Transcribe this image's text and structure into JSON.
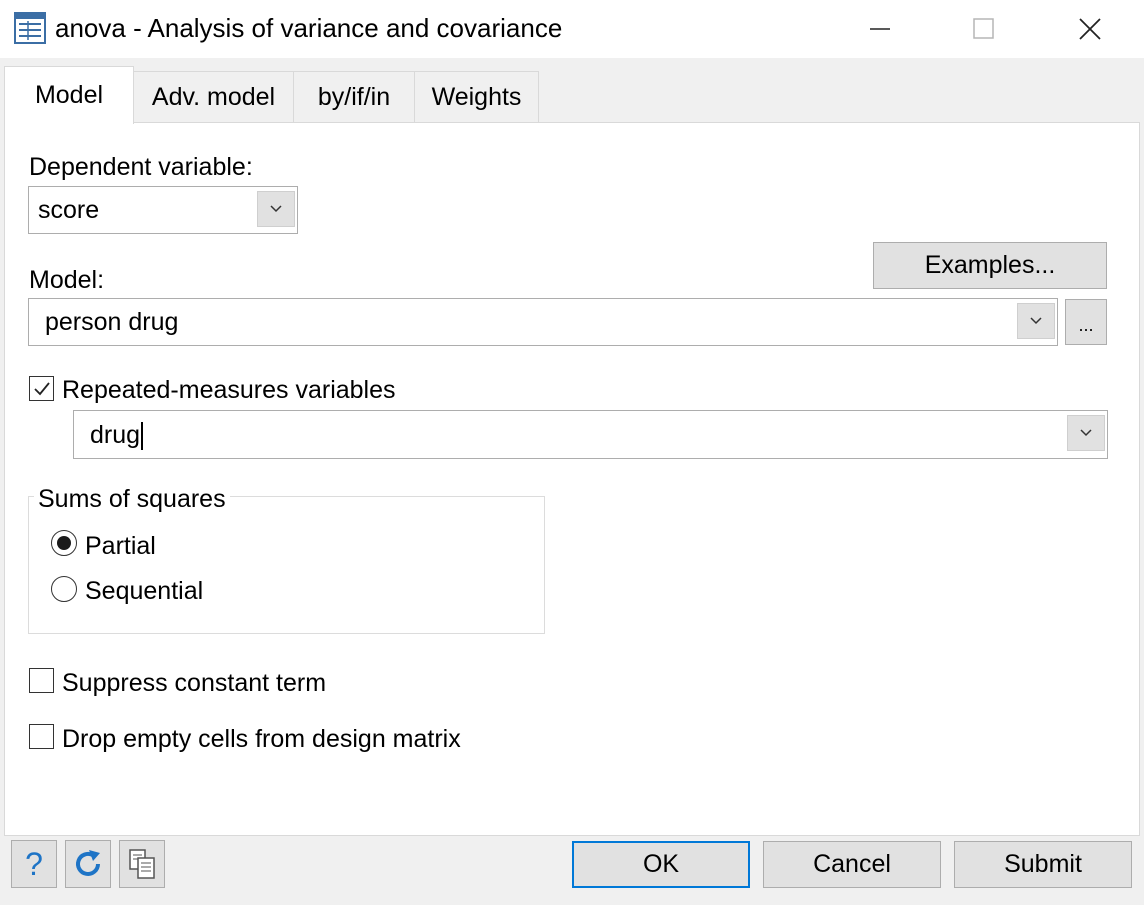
{
  "window": {
    "title": "anova - Analysis of variance and covariance",
    "icons": {
      "app": "dialog-icon",
      "minimize": "minimize-icon",
      "maximize": "maximize-icon",
      "close": "close-icon"
    }
  },
  "tabs": [
    {
      "label": "Model",
      "active": true
    },
    {
      "label": "Adv. model",
      "active": false
    },
    {
      "label": "by/if/in",
      "active": false
    },
    {
      "label": "Weights",
      "active": false
    }
  ],
  "model_tab": {
    "dependent_label": "Dependent variable:",
    "dependent_value": "score",
    "model_label": "Model:",
    "model_value": "person drug",
    "examples_button": "Examples...",
    "browse_button": "...",
    "repeated_label": "Repeated-measures variables",
    "repeated_checked": true,
    "repeated_value": "drug",
    "sums_group": {
      "title": "Sums of squares",
      "options": [
        {
          "label": "Partial",
          "selected": true
        },
        {
          "label": "Sequential",
          "selected": false
        }
      ]
    },
    "suppress_label": "Suppress constant term",
    "suppress_checked": false,
    "drop_label": "Drop empty cells from design matrix",
    "drop_checked": false
  },
  "footer": {
    "help_icon": "help-icon",
    "reset_icon": "reset-icon",
    "copy_icon": "copy-icon",
    "ok": "OK",
    "cancel": "Cancel",
    "submit": "Submit"
  },
  "colors": {
    "accent": "#0078d7",
    "help": "#1e74c6",
    "background": "#f0f0f0",
    "panel": "#ffffff"
  }
}
